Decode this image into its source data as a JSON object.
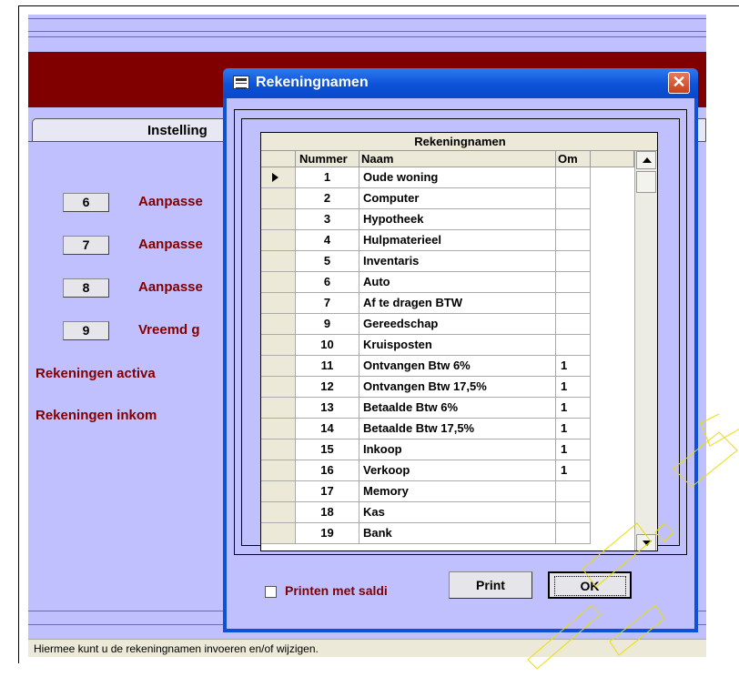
{
  "background_app": {
    "tab_label": "Instelling",
    "rows": [
      {
        "button": "6",
        "label": "Aanpasse"
      },
      {
        "button": "7",
        "label": "Aanpasse"
      },
      {
        "button": "8",
        "label": "Aanpasse"
      },
      {
        "button": "9",
        "label": "Vreemd g"
      }
    ],
    "link1": "Rekeningen activa",
    "link2": "Rekeningen inkom",
    "status": "Hiermee kunt u de rekeningnamen invoeren en/of wijzigen."
  },
  "dialog": {
    "title": "Rekeningnamen",
    "close": "✕",
    "grid": {
      "title": "Rekeningnamen",
      "headers": {
        "nummer": "Nummer",
        "naam": "Naam",
        "om": "Om"
      },
      "rows": [
        {
          "num": "1",
          "naam": "Oude woning",
          "om": ""
        },
        {
          "num": "2",
          "naam": "Computer",
          "om": ""
        },
        {
          "num": "3",
          "naam": "Hypotheek",
          "om": ""
        },
        {
          "num": "4",
          "naam": "Hulpmaterieel",
          "om": ""
        },
        {
          "num": "5",
          "naam": "Inventaris",
          "om": ""
        },
        {
          "num": "6",
          "naam": "Auto",
          "om": ""
        },
        {
          "num": "7",
          "naam": "Af te dragen BTW",
          "om": ""
        },
        {
          "num": "9",
          "naam": "Gereedschap",
          "om": ""
        },
        {
          "num": "10",
          "naam": "Kruisposten",
          "om": ""
        },
        {
          "num": "11",
          "naam": "Ontvangen Btw 6%",
          "om": "1"
        },
        {
          "num": "12",
          "naam": "Ontvangen Btw 17,5%",
          "om": "1"
        },
        {
          "num": "13",
          "naam": "Betaalde Btw 6%",
          "om": "1"
        },
        {
          "num": "14",
          "naam": "Betaalde Btw 17,5%",
          "om": "1"
        },
        {
          "num": "15",
          "naam": "Inkoop",
          "om": "1"
        },
        {
          "num": "16",
          "naam": "Verkoop",
          "om": "1"
        },
        {
          "num": "17",
          "naam": "Memory",
          "om": ""
        },
        {
          "num": "18",
          "naam": "Kas",
          "om": ""
        },
        {
          "num": "19",
          "naam": "Bank",
          "om": ""
        }
      ]
    },
    "checkbox_label": "Printen met saldi",
    "print_label": "Print",
    "ok_label": "OK"
  }
}
